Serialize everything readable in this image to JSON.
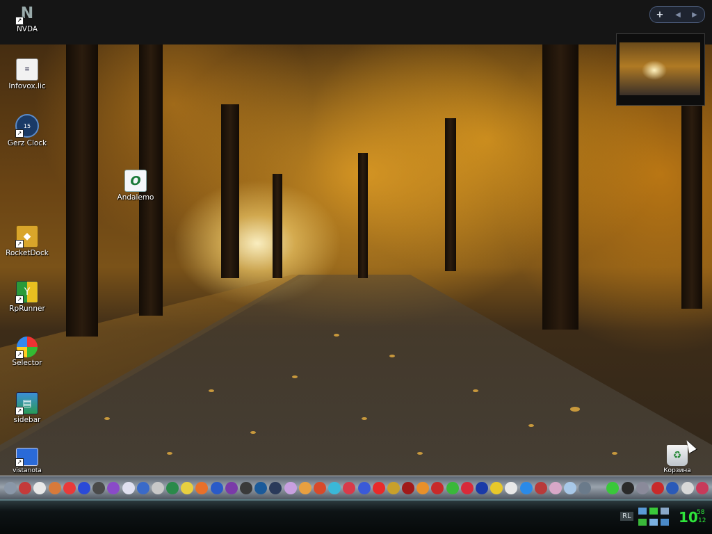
{
  "desktop": {
    "icons": [
      {
        "name": "nvda-icon",
        "label": "NVDA"
      },
      {
        "name": "infovox-lic-icon",
        "label": "Infovox.lic"
      },
      {
        "name": "gerz-clock-icon",
        "label": "Gerz Clock"
      },
      {
        "name": "andalemo-icon",
        "label": "Andalemo"
      },
      {
        "name": "rocketdock-icon",
        "label": "RocketDock"
      },
      {
        "name": "rprunner-icon",
        "label": "RpRunner"
      },
      {
        "name": "selector-icon",
        "label": "Selector"
      },
      {
        "name": "sidebar-icon",
        "label": "sidebar"
      },
      {
        "name": "vistanota-icon",
        "label": "vistanota"
      },
      {
        "name": "recycle-bin-icon",
        "label": "Корзина"
      }
    ]
  },
  "topbar": {
    "add_label": "+",
    "prev_label": "◀",
    "next_label": "▶"
  },
  "tray": {
    "language": "RL",
    "clock_hour": "10",
    "clock_minute": "58",
    "clock_second": "12"
  },
  "colors": {
    "clock": "#2ee53a",
    "dock": "#9aa3ad",
    "taskbar": "#0e1416"
  }
}
